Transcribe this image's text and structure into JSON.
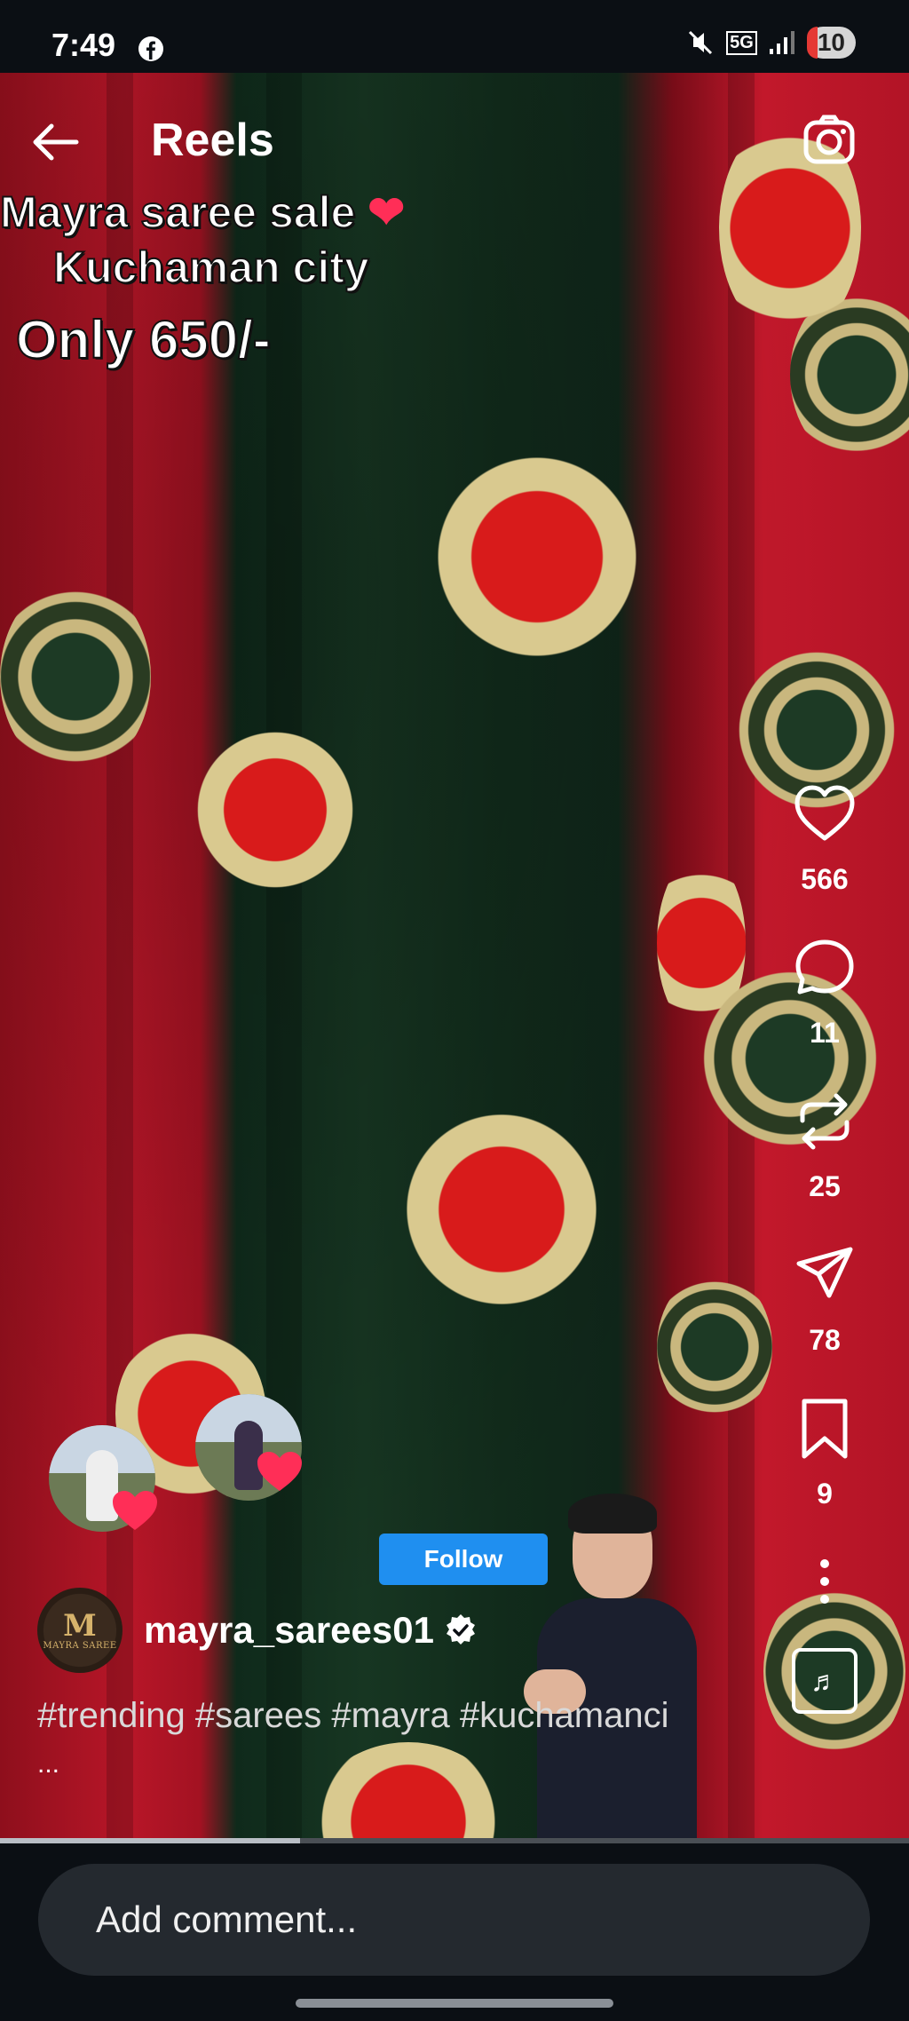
{
  "status_bar": {
    "time": "7:49",
    "network": "5G",
    "battery": "10"
  },
  "header": {
    "title": "Reels"
  },
  "video_caption": {
    "line1": "Mayra saree sale",
    "line1_emoji": "❤",
    "line2": "Kuchaman city",
    "line3": "Only 650/-"
  },
  "actions": {
    "likes": "566",
    "comments": "11",
    "reposts": "25",
    "shares": "78",
    "saves": "9"
  },
  "account": {
    "username": "mayra_sarees01",
    "avatar_monogram": "M",
    "avatar_brand": "MAYRA SAREE",
    "follow_label": "Follow"
  },
  "post": {
    "hashtags": "#trending #sarees #mayra #kuchamanci",
    "more": "..."
  },
  "playback": {
    "progress_percent": 33
  },
  "comment": {
    "placeholder": "Add comment..."
  },
  "colors": {
    "follow": "#1f8ff0",
    "heart": "#ff2e57",
    "background": "#0b0f14"
  }
}
